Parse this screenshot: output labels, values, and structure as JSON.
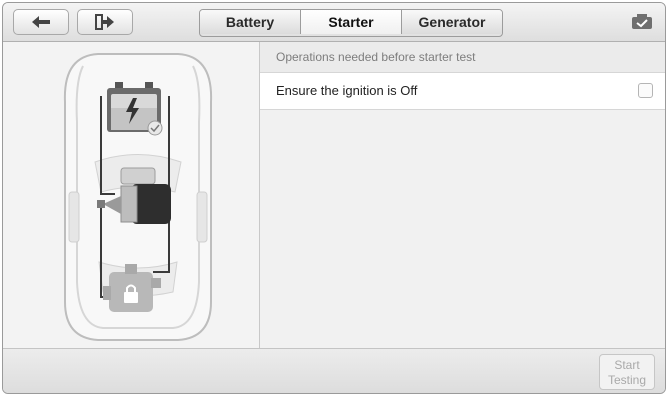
{
  "toolbar": {
    "back_icon": "back-arrow-icon",
    "exit_icon": "exit-icon",
    "tabs": [
      {
        "label": "Battery",
        "active": false
      },
      {
        "label": "Starter",
        "active": true
      },
      {
        "label": "Generator",
        "active": false
      }
    ],
    "status_icon": "vci-connected-icon"
  },
  "diagram": {
    "icons": [
      "car-outline-icon",
      "battery-icon",
      "starter-motor-icon",
      "generator-icon",
      "lock-icon"
    ]
  },
  "operations": {
    "header": "Operations needed before starter test",
    "items": [
      {
        "label": "Ensure the ignition is Off",
        "checked": false
      }
    ]
  },
  "footer": {
    "start_label_line1": "Start",
    "start_label_line2": "Testing",
    "start_enabled": false
  },
  "colors": {
    "tab_active_bg": "#ffffff",
    "disabled_text": "#a9a9a9"
  }
}
